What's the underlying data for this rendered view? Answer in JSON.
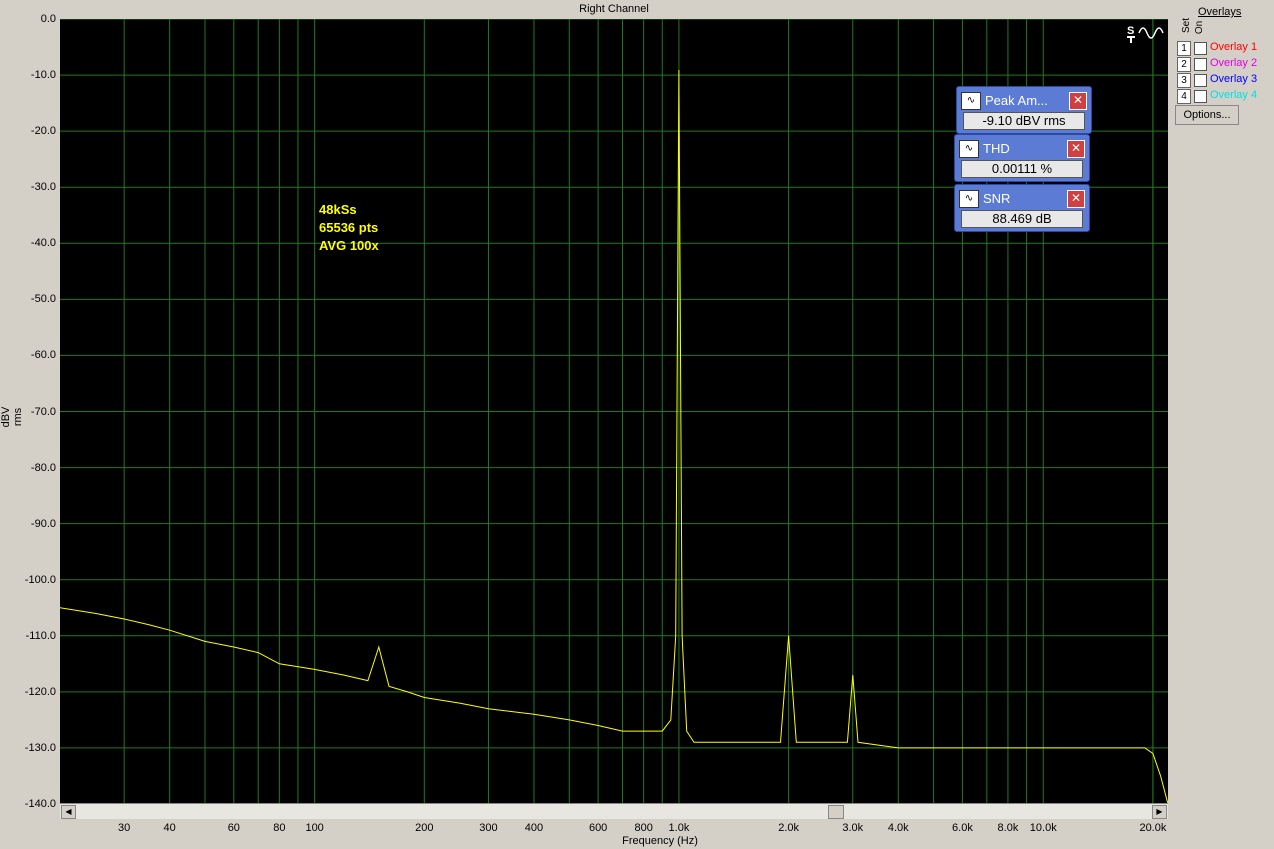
{
  "window": {
    "title": "Right Channel"
  },
  "chart_data": {
    "type": "line",
    "title": "Right Channel",
    "xlabel": "Frequency (Hz)",
    "ylabel": "dBV rms",
    "xscale": "log",
    "xlim": [
      20,
      22000
    ],
    "ylim": [
      -140,
      0
    ],
    "grid": true,
    "y_tick_labels": [
      "0.0",
      "-10.0",
      "-20.0",
      "-30.0",
      "-40.0",
      "-50.0",
      "-60.0",
      "-70.0",
      "-80.0",
      "-90.0",
      "-100.0",
      "-110.0",
      "-120.0",
      "-130.0",
      "-140.0"
    ],
    "y_tick_values": [
      0,
      -10,
      -20,
      -30,
      -40,
      -50,
      -60,
      -70,
      -80,
      -90,
      -100,
      -110,
      -120,
      -130,
      -140
    ],
    "x_ticks": [
      {
        "v": 30,
        "l": "30"
      },
      {
        "v": 40,
        "l": "40"
      },
      {
        "v": 60,
        "l": "60"
      },
      {
        "v": 80,
        "l": "80"
      },
      {
        "v": 100,
        "l": "100"
      },
      {
        "v": 200,
        "l": "200"
      },
      {
        "v": 300,
        "l": "300"
      },
      {
        "v": 400,
        "l": "400"
      },
      {
        "v": 600,
        "l": "600"
      },
      {
        "v": 800,
        "l": "800"
      },
      {
        "v": 1000,
        "l": "1.0k"
      },
      {
        "v": 2000,
        "l": "2.0k"
      },
      {
        "v": 3000,
        "l": "3.0k"
      },
      {
        "v": 4000,
        "l": "4.0k"
      },
      {
        "v": 6000,
        "l": "6.0k"
      },
      {
        "v": 8000,
        "l": "8.0k"
      },
      {
        "v": 10000,
        "l": "10.0k"
      },
      {
        "v": 20000,
        "l": "20.0k"
      }
    ],
    "series": [
      {
        "color": "#ffff00",
        "x": [
          20,
          25,
          30,
          35,
          40,
          50,
          60,
          70,
          80,
          100,
          120,
          140,
          150,
          160,
          180,
          200,
          250,
          300,
          400,
          500,
          600,
          700,
          800,
          900,
          950,
          980,
          1000,
          1020,
          1050,
          1100,
          1300,
          1600,
          1900,
          2000,
          2100,
          2500,
          2900,
          3000,
          3100,
          4000,
          5000,
          6000,
          7000,
          8000,
          10000,
          13000,
          16000,
          19000,
          20000,
          21000,
          22000
        ],
        "y": [
          -105,
          -106,
          -107,
          -108,
          -109,
          -111,
          -112,
          -113,
          -115,
          -116,
          -117,
          -118,
          -112,
          -119,
          -120,
          -121,
          -122,
          -123,
          -124,
          -125,
          -126,
          -127,
          -127,
          -127,
          -125,
          -110,
          -9.1,
          -110,
          -127,
          -129,
          -129,
          -129,
          -129,
          -110,
          -129,
          -129,
          -129,
          -117,
          -129,
          -130,
          -130,
          -130,
          -130,
          -130,
          -130,
          -130,
          -130,
          -130,
          -131,
          -135,
          -140
        ]
      }
    ]
  },
  "annotation": {
    "lines": [
      "48kSs",
      "65536 pts",
      "AVG 100x"
    ]
  },
  "meters": [
    {
      "title": "Peak Am...",
      "value": "-9.10 dBV rms"
    },
    {
      "title": "THD",
      "value": "0.00111 %"
    },
    {
      "title": "SNR",
      "value": "88.469 dB"
    }
  ],
  "overlays": {
    "header": "Overlays",
    "set_label": "Set",
    "on_label": "On",
    "items": [
      {
        "num": "1",
        "label": "Overlay 1",
        "color": "#ff0000"
      },
      {
        "num": "2",
        "label": "Overlay 2",
        "color": "#e000e0"
      },
      {
        "num": "3",
        "label": "Overlay 3",
        "color": "#0000ff"
      },
      {
        "num": "4",
        "label": "Overlay 4",
        "color": "#00e0e0"
      }
    ],
    "options_label": "Options..."
  }
}
